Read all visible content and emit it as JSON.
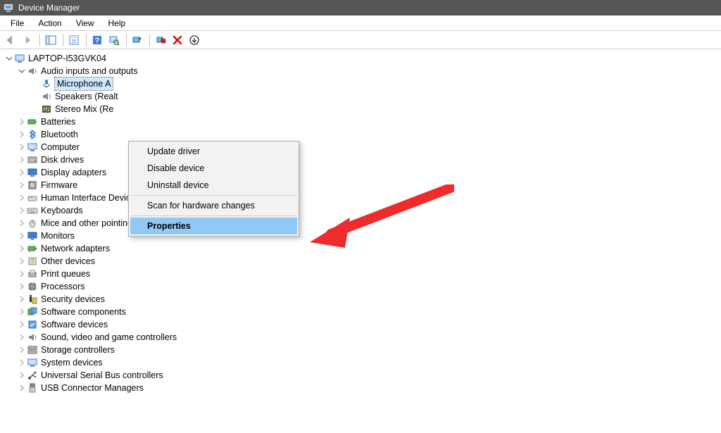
{
  "app": {
    "title": "Device Manager"
  },
  "menu": {
    "file": "File",
    "action": "Action",
    "view": "View",
    "help": "Help"
  },
  "tree": {
    "root": "LAPTOP-I53GVK04",
    "audio_category": "Audio inputs and outputs",
    "microphone": "Microphone A",
    "speakers": "Speakers (Realt",
    "stereomix": "Stereo Mix (Re",
    "categories": [
      "Batteries",
      "Bluetooth",
      "Computer",
      "Disk drives",
      "Display adapters",
      "Firmware",
      "Human Interface Devices",
      "Keyboards",
      "Mice and other pointing devices",
      "Monitors",
      "Network adapters",
      "Other devices",
      "Print queues",
      "Processors",
      "Security devices",
      "Software components",
      "Software devices",
      "Sound, video and game controllers",
      "Storage controllers",
      "System devices",
      "Universal Serial Bus controllers",
      "USB Connector Managers"
    ]
  },
  "context_menu": {
    "update": "Update driver",
    "disable": "Disable device",
    "uninstall": "Uninstall device",
    "scan": "Scan for hardware changes",
    "properties": "Properties"
  }
}
